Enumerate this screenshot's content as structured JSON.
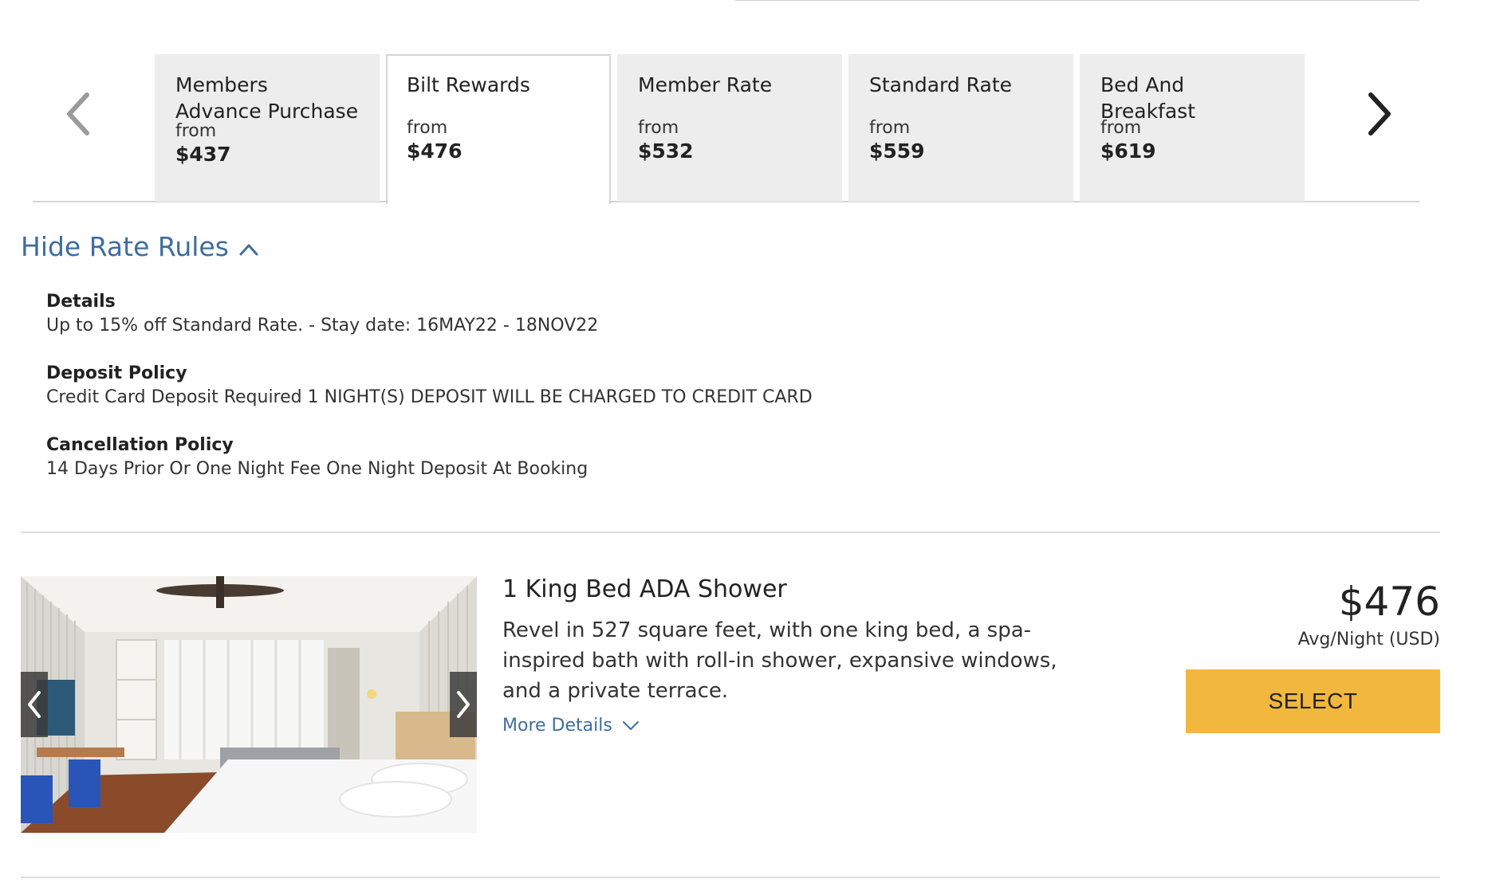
{
  "rate_tabs": [
    {
      "name": "Members Advance Purchase",
      "from": "from",
      "price": "$437"
    },
    {
      "name": "Bilt Rewards",
      "from": "from",
      "price": "$476"
    },
    {
      "name": "Member Rate",
      "from": "from",
      "price": "$532"
    },
    {
      "name": "Standard Rate",
      "from": "from",
      "price": "$559"
    },
    {
      "name": "Bed And Breakfast",
      "from": "from",
      "price": "$619"
    }
  ],
  "active_tab": "Bilt Rewards",
  "icons": {
    "prev": "chevron-left-icon",
    "next": "chevron-right-icon",
    "collapse": "chevron-up-icon",
    "expand": "chevron-down-icon"
  },
  "rate_rules": {
    "toggle_label": "Hide Rate Rules",
    "items": [
      {
        "title": "Details",
        "text": "Up to 15% off Standard Rate. - Stay date: 16MAY22 - 18NOV22"
      },
      {
        "title": "Deposit Policy",
        "text": "Credit Card Deposit Required 1 NIGHT(S) DEPOSIT WILL BE CHARGED TO CREDIT CARD"
      },
      {
        "title": "Cancellation Policy",
        "text": "14 Days Prior Or One Night Fee One Night Deposit At Booking"
      }
    ]
  },
  "room": {
    "title": "1 King Bed ADA Shower",
    "description": "Revel in 527 square feet, with one king bed, a spa-inspired bath with roll-in shower, expansive windows, and a private terrace.",
    "more_details": "More Details",
    "price": "$476",
    "price_note": "Avg/Night (USD)",
    "select_label": "SELECT"
  },
  "colors": {
    "link": "#3f6d9e",
    "select_button": "#f2b83d",
    "tab_bg": "#ededed"
  }
}
